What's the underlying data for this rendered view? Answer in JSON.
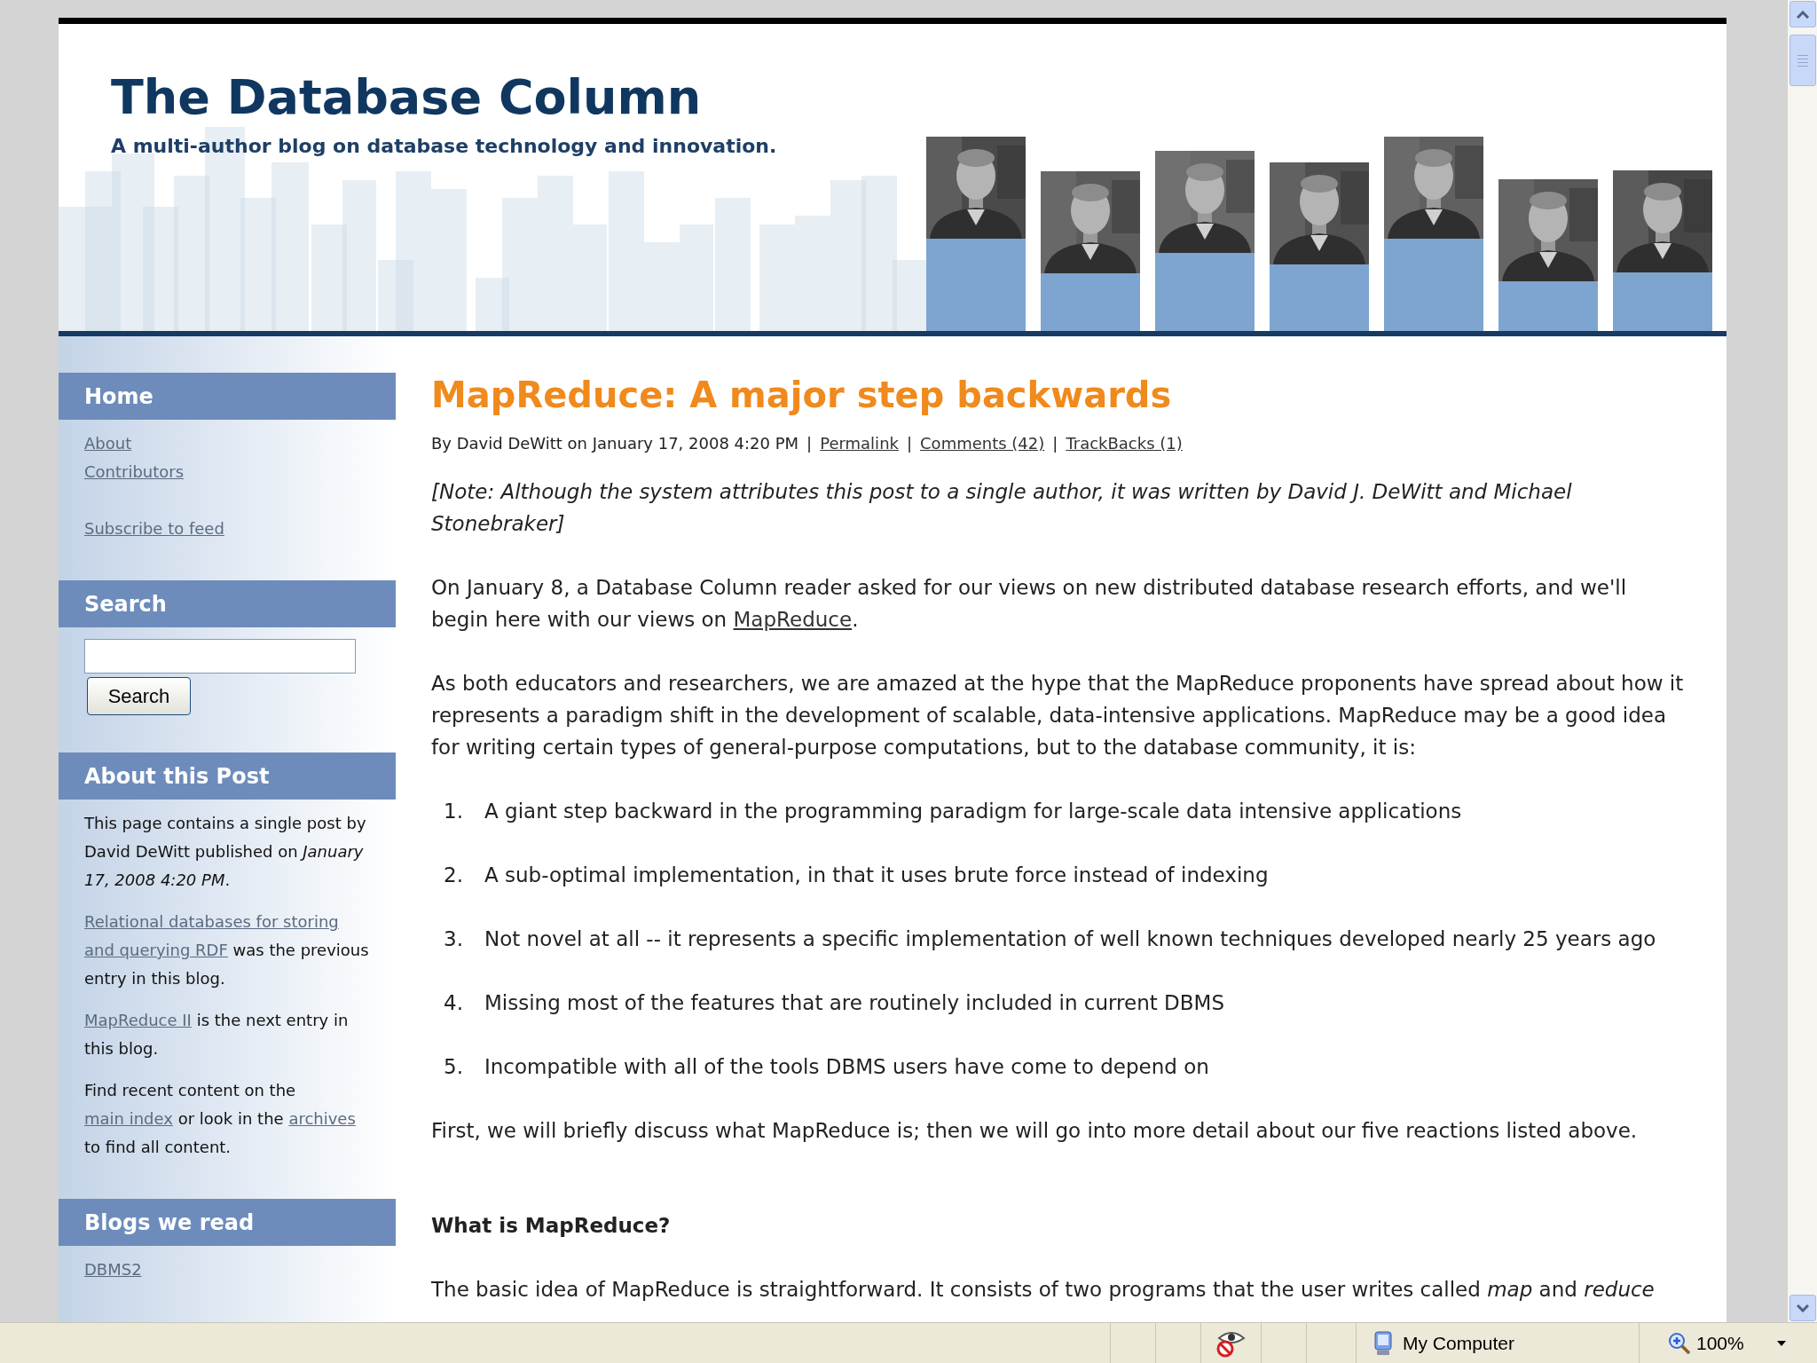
{
  "header": {
    "title": "The Database Column",
    "tagline": "A multi-author blog on database technology and innovation."
  },
  "sidebar": {
    "sections": [
      {
        "kind": "links",
        "heading": "Home",
        "link_groups": [
          [
            "About",
            "Contributors"
          ],
          [
            "Subscribe to feed"
          ]
        ]
      },
      {
        "kind": "search",
        "heading": "Search",
        "button": "Search"
      },
      {
        "kind": "paragraphs",
        "heading": "About this Post",
        "paragraphs": [
          [
            {
              "kind": "text",
              "text": "This page contains a single post by David DeWitt published on *January 17, 2008 4:20 PM*."
            }
          ],
          [
            {
              "kind": "link",
              "text": "Relational databases for storing"
            },
            {
              "kind": "break"
            },
            {
              "kind": "link",
              "text": "and querying RDF"
            },
            {
              "kind": "text",
              "text": " was the previous entry in this blog."
            }
          ],
          [
            {
              "kind": "link",
              "text": "MapReduce II"
            },
            {
              "kind": "text",
              "text": " is the next entry in this blog."
            }
          ],
          [
            {
              "kind": "text",
              "text": "Find recent content on the "
            },
            {
              "kind": "link",
              "text": "main index"
            },
            {
              "kind": "text",
              "text": " or look in the "
            },
            {
              "kind": "link",
              "text": "archives"
            },
            {
              "kind": "text",
              "text": " to find all content."
            }
          ]
        ]
      },
      {
        "kind": "links",
        "heading": "Blogs we read",
        "link_groups": [
          [
            "DBMS2"
          ]
        ]
      }
    ]
  },
  "post": {
    "title": "MapReduce: A major step backwards",
    "byline": [
      {
        "kind": "text",
        "text": "By David DeWitt on January 17, 2008 4:20 PM"
      },
      {
        "kind": "separator",
        "text": "|"
      },
      {
        "kind": "link",
        "text": "Permalink"
      },
      {
        "kind": "separator",
        "text": "|"
      },
      {
        "kind": "link",
        "text": "Comments (42)"
      },
      {
        "kind": "separator",
        "text": "|"
      },
      {
        "kind": "link",
        "text": "TrackBacks (1)"
      }
    ],
    "blocks": [
      {
        "kind": "note",
        "text": "[Note: Although the system attributes this post to a single author, it was written by David J. DeWitt and Michael Stonebraker]"
      },
      {
        "kind": "paragraph",
        "segments": [
          {
            "kind": "text",
            "text": "On January 8, a Database Column reader asked for our views on new distributed database research efforts, and we'll begin here with our views on "
          },
          {
            "kind": "link",
            "text": "MapReduce"
          },
          {
            "kind": "text",
            "text": "."
          }
        ]
      },
      {
        "kind": "paragraph",
        "segments": [
          {
            "kind": "text",
            "text": "As both educators and researchers, we are amazed at the hype that the MapReduce proponents have spread about how it represents a paradigm shift in the development of scalable, data-intensive applications. MapReduce may be a good idea for writing certain types of general-purpose computations, but to the database community, it is:"
          }
        ]
      },
      {
        "kind": "list",
        "items": [
          {
            "number": "1.",
            "text": "A giant step backward in the programming paradigm for large-scale data intensive applications"
          },
          {
            "number": "2.",
            "text": "A sub-optimal implementation, in that it uses brute force instead of indexing"
          },
          {
            "number": "3.",
            "text": "Not novel at all -- it represents a specific implementation of well known techniques developed nearly 25 years ago"
          },
          {
            "number": "4.",
            "text": "Missing most of the features that are routinely included in current DBMS"
          },
          {
            "number": "5.",
            "text": "Incompatible with all of the tools DBMS users have come to depend on"
          }
        ]
      },
      {
        "kind": "paragraph",
        "segments": [
          {
            "kind": "text",
            "text": "First, we will briefly discuss what MapReduce is; then we will go into more detail about our five reactions listed above."
          }
        ]
      },
      {
        "kind": "heading",
        "text": "What is MapReduce?"
      },
      {
        "kind": "paragraph",
        "segments": [
          {
            "kind": "text",
            "text": "The basic idea of MapReduce is straightforward. It consists of two programs that the user writes called *map* and *reduce*"
          }
        ]
      }
    ]
  },
  "status_bar": {
    "zone": "My Computer",
    "zoom": "100%"
  }
}
